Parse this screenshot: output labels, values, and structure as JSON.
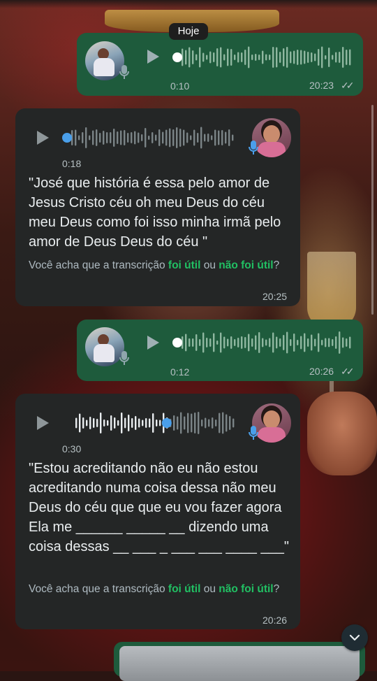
{
  "date_chip": "Hoje",
  "messages": [
    {
      "direction": "outgoing",
      "type": "voice",
      "duration": "0:10",
      "time": "20:23",
      "ticks": "✓✓"
    },
    {
      "direction": "incoming",
      "type": "voice",
      "duration": "0:18",
      "time": "20:25",
      "transcript": "\"José que história é essa pelo amor de Jesus Cristo céu oh meu Deus do céu meu Deus como foi isso minha irmã pelo amor de Deus Deus do céu \"",
      "feedback": {
        "before": "Você acha que a transcrição ",
        "useful": "foi útil",
        "middle": " ou ",
        "not_useful": "não foi útil",
        "after": "?"
      },
      "progress": 0.0
    },
    {
      "direction": "outgoing",
      "type": "voice",
      "duration": "0:12",
      "time": "20:26",
      "ticks": "✓✓"
    },
    {
      "direction": "incoming",
      "type": "voice",
      "duration": "0:30",
      "time": "20:26",
      "transcript": "\"Estou acreditando não eu não estou acreditando numa coisa dessa não meu Deus do céu que que eu vou fazer agora Ela me ______ _____ __ dizendo uma coisa dessas __ ___ _ ___ ___ ____ ___\"",
      "feedback": {
        "before": "Você acha que a transcrição ",
        "useful": "foi útil",
        "middle": " ou ",
        "not_useful": "não foi útil",
        "after": "?"
      },
      "progress": 0.6
    }
  ],
  "icons": {
    "play": "play-icon",
    "mic": "mic-icon",
    "scroll_down": "chevron-down-icon"
  },
  "colors": {
    "outgoing_bubble": "#1e5b3c",
    "incoming_bubble": "#242626",
    "link_green": "#21c063",
    "progress_blue": "#4a9fea",
    "mic_blue": "#4a9fea"
  }
}
